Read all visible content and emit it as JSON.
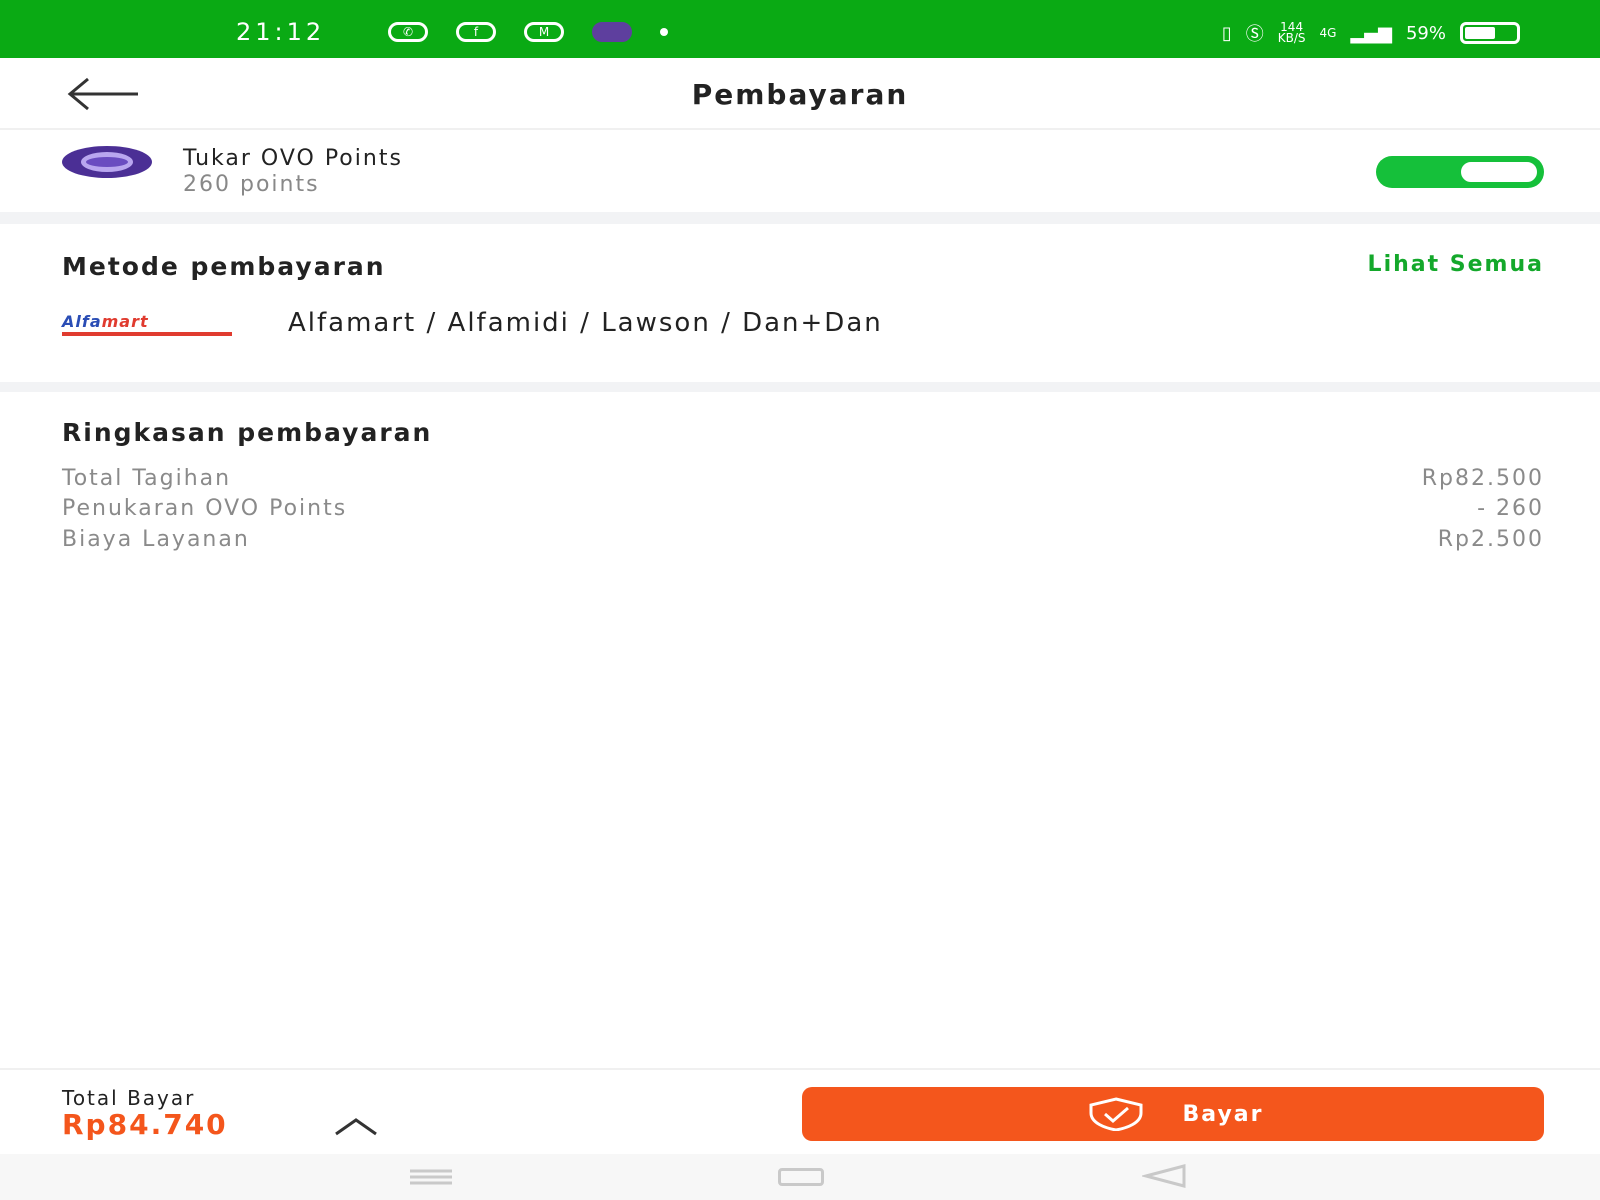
{
  "status_bar": {
    "time": "21:12",
    "net_speed_top": "144",
    "net_speed_bottom": "KB/S",
    "network": "4G",
    "battery": "59%",
    "battery_level": 0.59
  },
  "header": {
    "title": "Pembayaran"
  },
  "ovo_points": {
    "title": "Tukar OVO Points",
    "points": "260 points",
    "toggle_on": true
  },
  "payment_method": {
    "title": "Metode pembayaran",
    "see_all": "Lihat Semua",
    "logo_text_a": "Alfa",
    "logo_text_b": "mart",
    "selected": "Alfamart / Alfamidi / Lawson / Dan+Dan"
  },
  "summary": {
    "title": "Ringkasan pembayaran",
    "rows": [
      {
        "label": "Total Tagihan",
        "value": "Rp82.500"
      },
      {
        "label": "Penukaran OVO Points",
        "value": "- 260"
      },
      {
        "label": "Biaya Layanan",
        "value": "Rp2.500"
      }
    ]
  },
  "footer": {
    "total_label": "Total Bayar",
    "total_value": "Rp84.740",
    "pay_label": "Bayar"
  },
  "colors": {
    "status_green": "#0aaa14",
    "accent_green": "#14a82b",
    "orange": "#f4561c",
    "ovo_purple": "#4b2f95"
  }
}
